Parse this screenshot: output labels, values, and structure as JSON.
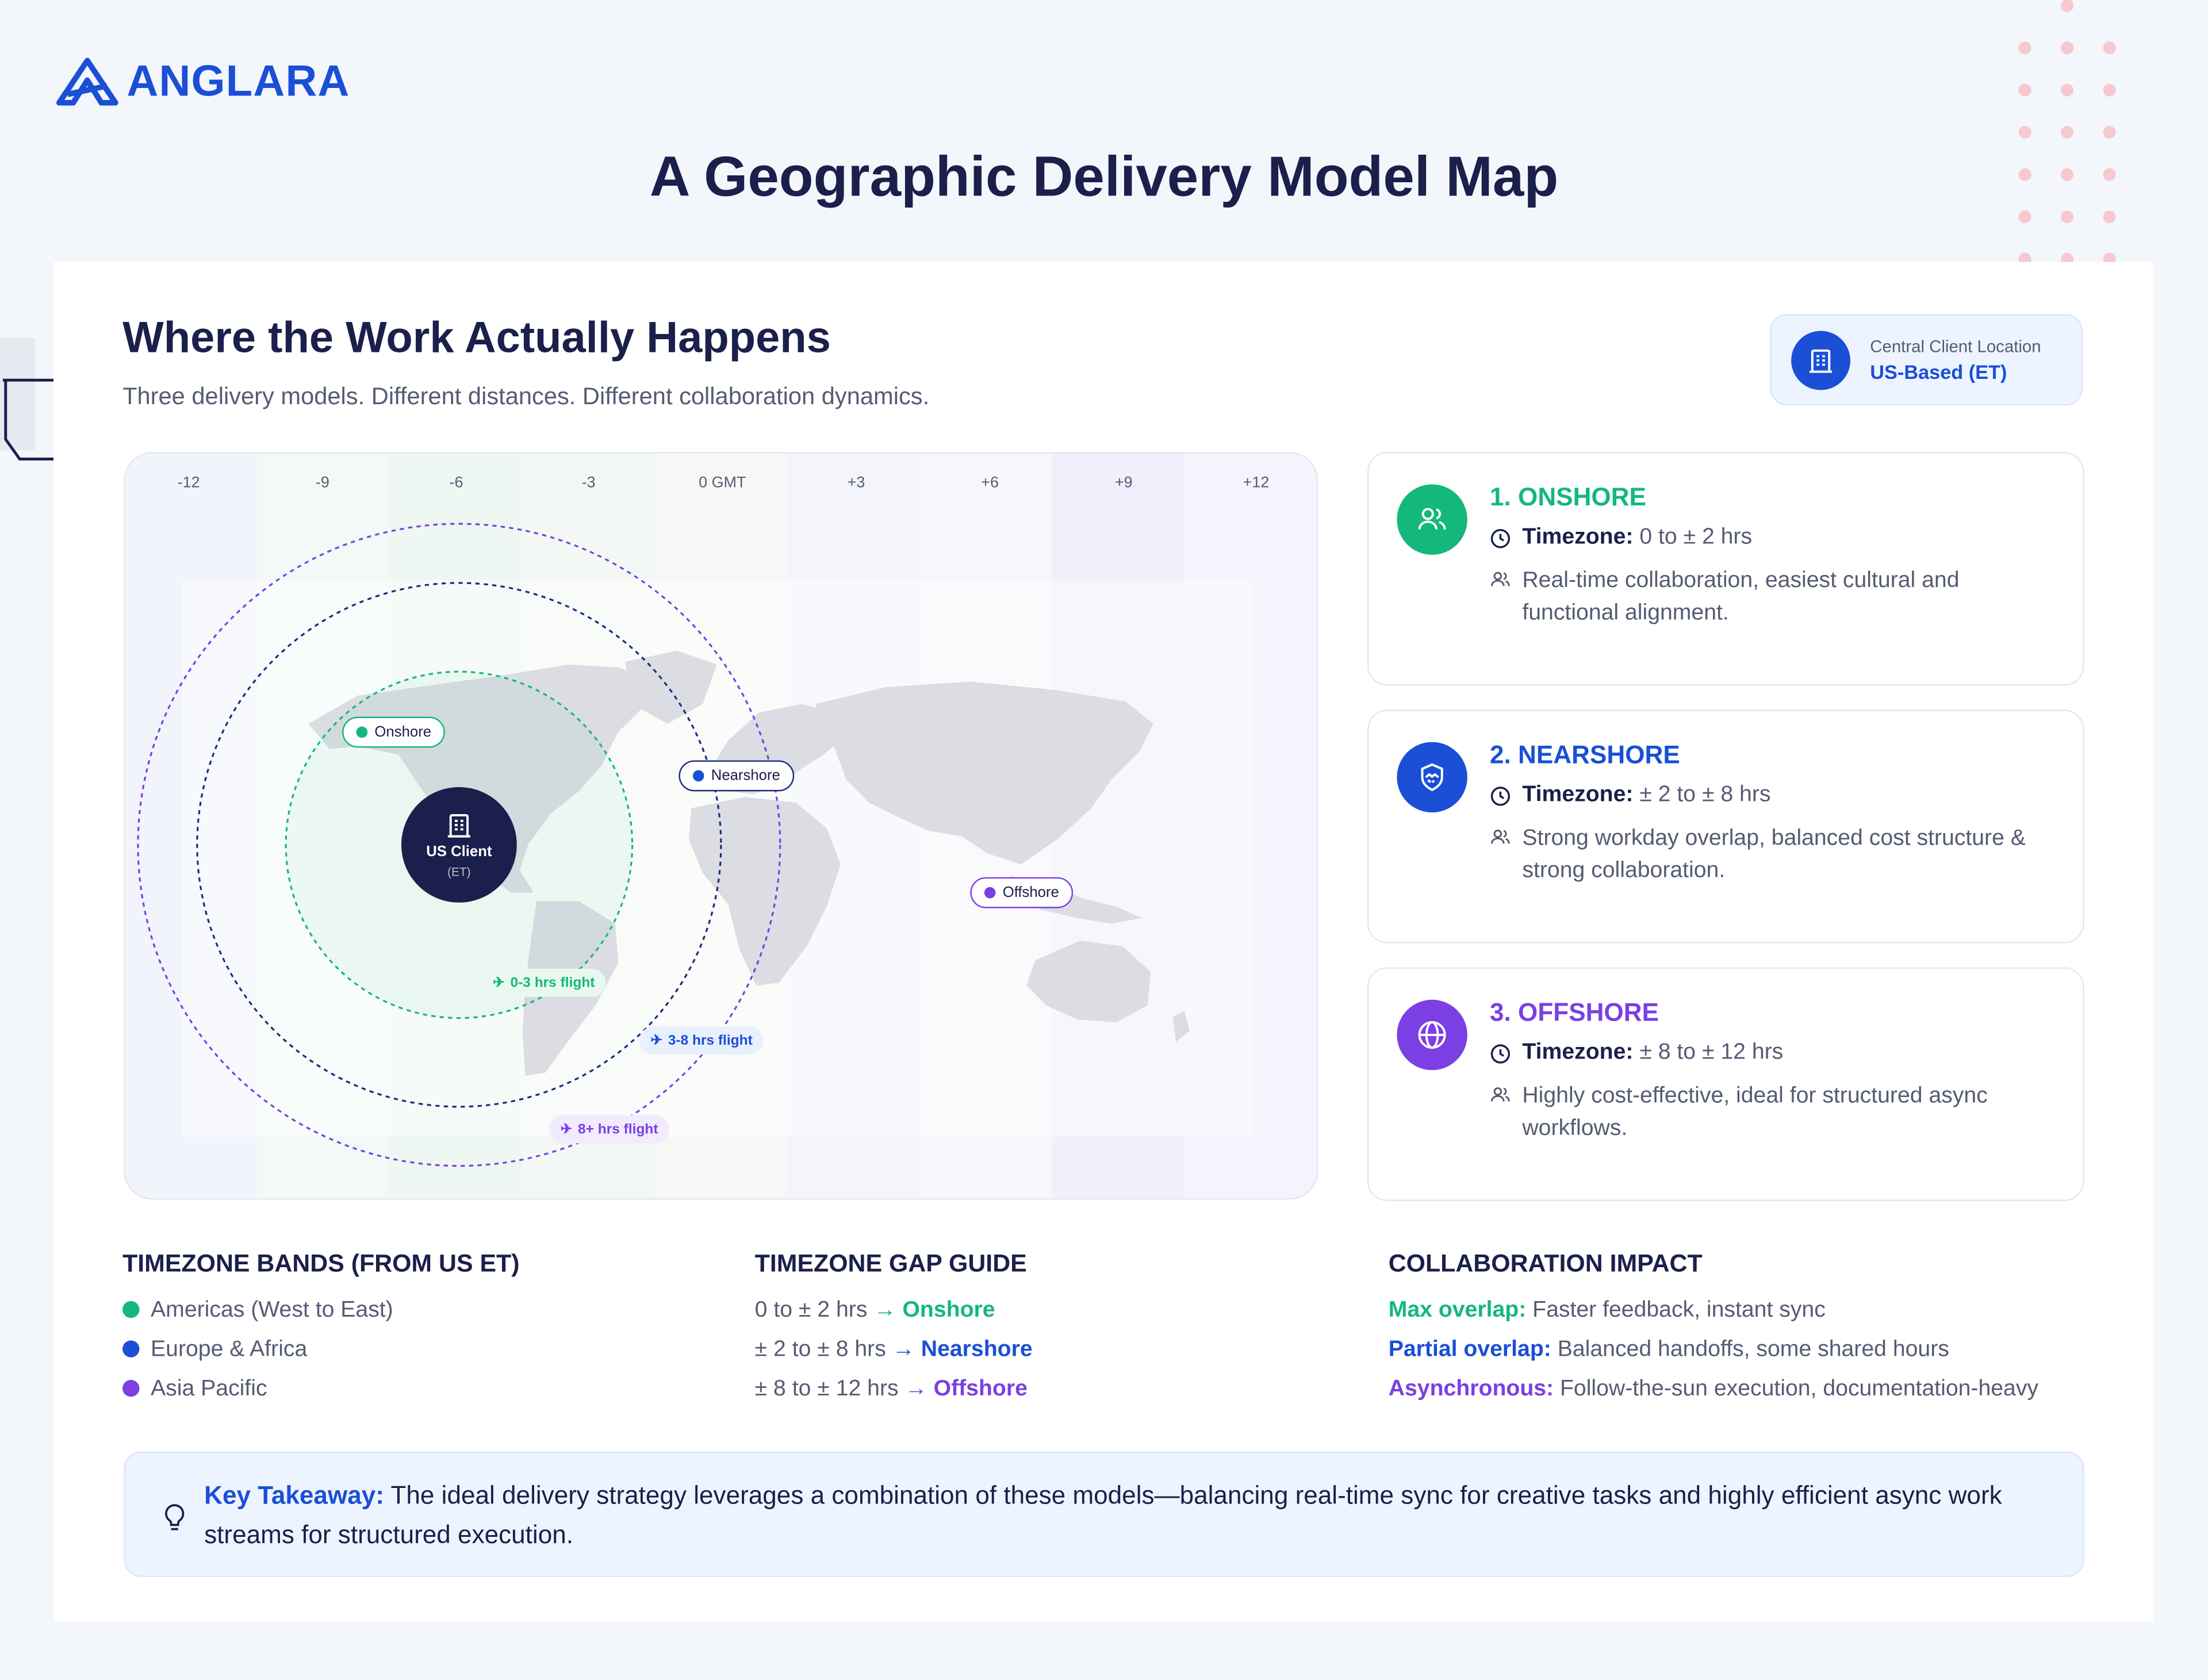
{
  "brand": {
    "name": "ANGLARA",
    "color": "#1a4fd6"
  },
  "title": "A Geographic Delivery Model Map",
  "section": {
    "title": "Where the Work Actually Happens",
    "subtitle": "Three delivery models. Different distances. Different collaboration dynamics."
  },
  "client_location": {
    "label": "Central Client Location",
    "value": "US-Based (ET)",
    "icon": "building-icon"
  },
  "map": {
    "timezones": [
      "-12",
      "-9",
      "-6",
      "-3",
      "0 GMT",
      "+3",
      "+6",
      "+9",
      "+12"
    ],
    "client": {
      "name": "US Client",
      "sub": "(ET)"
    },
    "pins": {
      "onshore": "Onshore",
      "nearshore": "Nearshore",
      "offshore": "Offshore"
    },
    "flights": {
      "onshore": "0-3 hrs flight",
      "nearshore": "3-8 hrs flight",
      "offshore": "8+ hrs flight"
    }
  },
  "colors": {
    "onshore": "#14b87a",
    "nearshore": "#1a4fd6",
    "offshore": "#7b3fe4",
    "text_dark": "#1b1f4b",
    "text_muted": "#555b73"
  },
  "models": [
    {
      "title": "1. ONSHORE",
      "tz_label": "Timezone:",
      "tz_value": "0 to ± 2 hrs",
      "desc": "Real-time collaboration, easiest cultural and functional alignment.",
      "icon": "users-icon"
    },
    {
      "title": "2. NEARSHORE",
      "tz_label": "Timezone:",
      "tz_value": "± 2 to ± 8 hrs",
      "desc": "Strong workday overlap, balanced cost structure & strong collaboration.",
      "icon": "handshake-icon"
    },
    {
      "title": "3. OFFSHORE",
      "tz_label": "Timezone:",
      "tz_value": "± 8 to ± 12 hrs",
      "desc": "Highly cost-effective, ideal for structured async workflows.",
      "icon": "globe-icon"
    }
  ],
  "bands": {
    "title": "TIMEZONE BANDS (FROM US ET)",
    "items": [
      "Americas (West to East)",
      "Europe & Africa",
      "Asia Pacific"
    ]
  },
  "gap_guide": {
    "title": "TIMEZONE GAP GUIDE",
    "items": [
      {
        "range": "0 to ± 2 hrs",
        "model": "Onshore"
      },
      {
        "range": "± 2 to ± 8 hrs",
        "model": "Nearshore"
      },
      {
        "range": "± 8 to ± 12 hrs",
        "model": "Offshore"
      }
    ]
  },
  "impact": {
    "title": "COLLABORATION IMPACT",
    "items": [
      {
        "label": "Max overlap:",
        "text": "Faster feedback, instant sync"
      },
      {
        "label": "Partial overlap:",
        "text": "Balanced handoffs, some shared hours"
      },
      {
        "label": "Asynchronous:",
        "text": "Follow-the-sun execution, documentation-heavy"
      }
    ]
  },
  "takeaway": {
    "label": "Key Takeaway:",
    "text": "The ideal delivery strategy leverages a combination of these models—balancing real-time sync for creative tasks and highly efficient async work streams for structured execution.",
    "icon": "lightbulb-icon"
  }
}
